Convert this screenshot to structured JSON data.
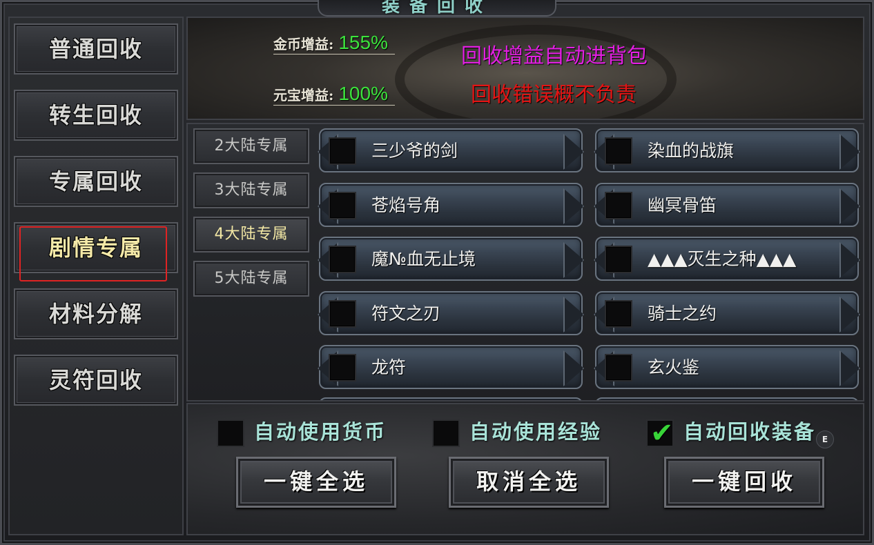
{
  "window": {
    "title": "装备回收"
  },
  "sidebar": {
    "items": [
      {
        "label": "普通回收"
      },
      {
        "label": "转生回收"
      },
      {
        "label": "专属回收"
      },
      {
        "label": "剧情专属",
        "active": true
      },
      {
        "label": "材料分解"
      },
      {
        "label": "灵符回收"
      }
    ]
  },
  "banner": {
    "gold_label": "金币增益:",
    "gold_value": "155%",
    "yuanbao_label": "元宝增益:",
    "yuanbao_value": "100%",
    "notice_1": "回收增益自动进背包",
    "notice_2": "回收错误概不负责",
    "colors": {
      "notice_1": "#e21fe2",
      "notice_2": "#e41414",
      "value": "#3ce23c"
    }
  },
  "subtabs": [
    {
      "label": "2大陆专属"
    },
    {
      "label": "3大陆专属"
    },
    {
      "label": "4大陆专属",
      "active": true
    },
    {
      "label": "5大陆专属"
    }
  ],
  "items": [
    {
      "label": "三少爷的剑",
      "checked": false
    },
    {
      "label": "染血的战旗",
      "checked": false
    },
    {
      "label": "苍焰号角",
      "checked": false
    },
    {
      "label": "幽冥骨笛",
      "checked": false
    },
    {
      "label": "魔№血无止境",
      "checked": false
    },
    {
      "label": "▲▲▲灭生之种▲▲▲",
      "checked": false
    },
    {
      "label": "符文之刃",
      "checked": false
    },
    {
      "label": "骑士之约",
      "checked": false
    },
    {
      "label": "龙符",
      "checked": false
    },
    {
      "label": "玄火鉴",
      "checked": false
    }
  ],
  "options": [
    {
      "label": "自动使用货币",
      "checked": false
    },
    {
      "label": "自动使用经验",
      "checked": false
    },
    {
      "label": "自动回收装备",
      "checked": true
    }
  ],
  "hotkey_badge": "E",
  "actions": {
    "select_all": "一键全选",
    "deselect_all": "取消全选",
    "recycle": "一键回收"
  }
}
